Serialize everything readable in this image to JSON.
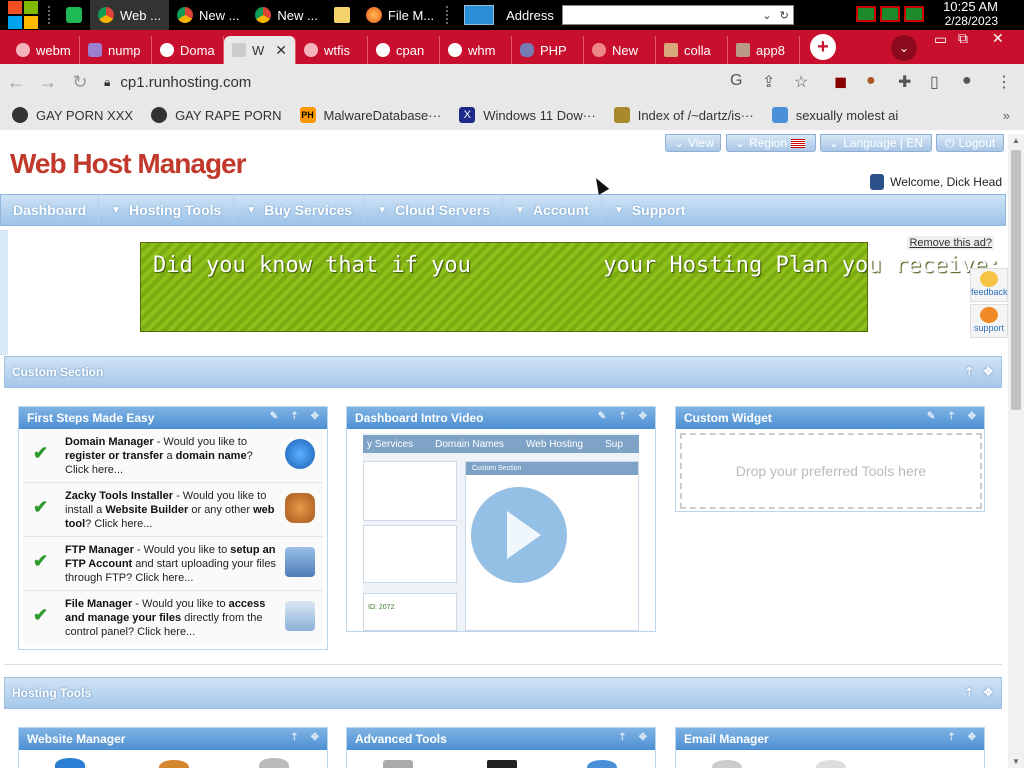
{
  "taskbar": {
    "items": [
      {
        "label": "Web ..."
      },
      {
        "label": "New ..."
      },
      {
        "label": "New ..."
      },
      {
        "label": "File M..."
      }
    ],
    "address_label": "Address",
    "clock_time": "10:25 AM",
    "clock_date": "2/28/2023"
  },
  "tabs": [
    {
      "label": "webm"
    },
    {
      "label": "nump"
    },
    {
      "label": "Doma"
    },
    {
      "label": "W",
      "active": true
    },
    {
      "label": "wtfis"
    },
    {
      "label": "cpan"
    },
    {
      "label": "whm"
    },
    {
      "label": "PHP"
    },
    {
      "label": "New"
    },
    {
      "label": "colla"
    },
    {
      "label": "app8"
    }
  ],
  "toolbar": {
    "url": "cp1.runhosting.com"
  },
  "bookmarks": [
    {
      "label": "GAY PORN XXX"
    },
    {
      "label": "GAY RAPE PORN"
    },
    {
      "label": "MalwareDatabase···"
    },
    {
      "label": "Windows 11 Dow···"
    },
    {
      "label": "Index of /~dartz/is···"
    },
    {
      "label": "sexually molest ai"
    }
  ],
  "page": {
    "logo": "Web Host Manager",
    "top_buttons": {
      "view": "View",
      "region": "Region",
      "language": "Language | EN",
      "logout": "Logout"
    },
    "welcome": "Welcome, Dick Head",
    "nav": [
      "Dashboard",
      "Hosting Tools",
      "Buy Services",
      "Cloud Servers",
      "Account",
      "Support"
    ],
    "remove_ad": "Remove this ad?",
    "banner_text": "Did you know that if you          your Hosting Plan you receive:",
    "side_buttons": {
      "feedback": "feedback",
      "support": "support"
    },
    "custom_section_title": "Custom Section",
    "first_steps": {
      "title": "First Steps Made Easy",
      "steps": [
        {
          "name": "Domain Manager",
          "text": " - Would you like to ",
          "strong": "register or transfer",
          "text2": " a ",
          "strong2": "domain name",
          "text3": "? Click here..."
        },
        {
          "name": "Zacky Tools Installer",
          "text": " - Would you like to install a ",
          "strong": "Website Builder",
          "text2": " or any other ",
          "strong2": "web tool",
          "text3": "? Click here..."
        },
        {
          "name": "FTP Manager",
          "text": " - Would you like to ",
          "strong": "setup an FTP Account",
          "text2": " and start uploading your files through FTP? Click here...",
          "strong2": "",
          "text3": ""
        },
        {
          "name": "File Manager",
          "text": " - Would you like to ",
          "strong": "access and manage your files",
          "text2": " directly from the control panel? Click here...",
          "strong2": "",
          "text3": ""
        }
      ]
    },
    "video_panel": {
      "title": "Dashboard Intro Video",
      "mini_nav": [
        "y Services",
        "Domain Names",
        "Web Hosting",
        "Sup"
      ],
      "mini_section": "Custom Section",
      "mini_footer": "ID: 2072"
    },
    "custom_widget": {
      "title": "Custom Widget",
      "drop_text": "Drop your preferred Tools here"
    },
    "hosting_tools_title": "Hosting Tools",
    "bottom_panels": [
      "Website Manager",
      "Advanced Tools",
      "Email Manager"
    ]
  },
  "colors": {
    "tabstrip": "#c8102e",
    "logo": "#c0392b",
    "nav_blue": "#9cc3e8",
    "banner_green": "#8fbf1a"
  }
}
